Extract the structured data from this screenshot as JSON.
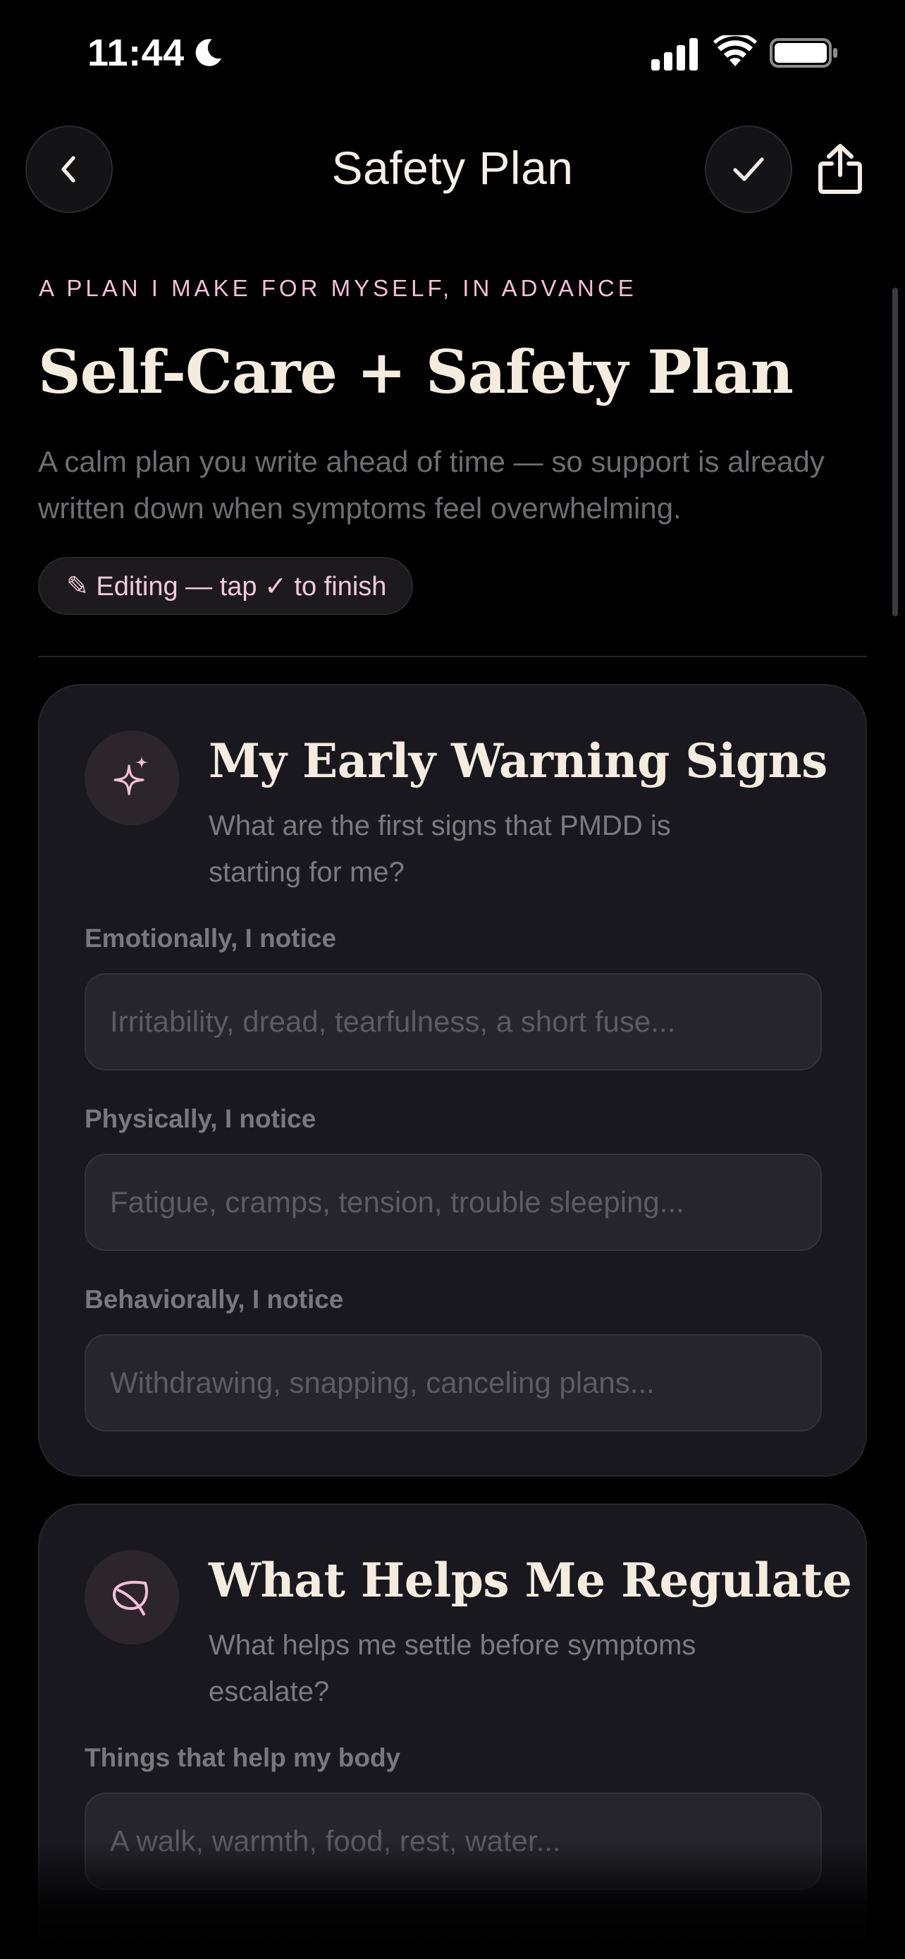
{
  "status_bar": {
    "time": "11:44",
    "icons": [
      "moon-icon",
      "signal-icon",
      "wifi-icon",
      "battery-icon"
    ]
  },
  "nav": {
    "title": "Safety Plan",
    "back_icon": "chevron-left-icon",
    "done_icon": "checkmark-icon",
    "share_icon": "share-icon"
  },
  "header": {
    "eyebrow": "A PLAN I MAKE FOR MYSELF, IN ADVANCE",
    "title": "Self-Care + Safety Plan",
    "intro": "A calm plan you write ahead of time — so support is already written down when symptoms feel overwhelming.",
    "edit_status": "✎ Editing — tap ✓ to finish"
  },
  "sections": [
    {
      "icon": "sparkle-icon",
      "title": "My Early Warning Signs",
      "subtitle": "What are the first signs that PMDD is starting for me?",
      "fields": [
        {
          "label": "Emotionally, I notice",
          "value": "",
          "placeholder": "Irritability, dread, tearfulness, a short fuse..."
        },
        {
          "label": "Physically, I notice",
          "value": "",
          "placeholder": "Fatigue, cramps, tension, trouble sleeping..."
        },
        {
          "label": "Behaviorally, I notice",
          "value": "",
          "placeholder": "Withdrawing, snapping, canceling plans..."
        }
      ]
    },
    {
      "icon": "leaf-icon",
      "title": "What Helps Me Regulate",
      "subtitle": "What helps me settle before symptoms escalate?",
      "fields": [
        {
          "label": "Things that help my body",
          "value": "",
          "placeholder": "A walk, warmth, food, rest, water..."
        }
      ]
    }
  ],
  "colors": {
    "background": "#000000",
    "card": "#19181f",
    "accent_pink": "#f3bfd8",
    "title_cream": "#f5ece0",
    "muted_text": "#7c7980"
  }
}
